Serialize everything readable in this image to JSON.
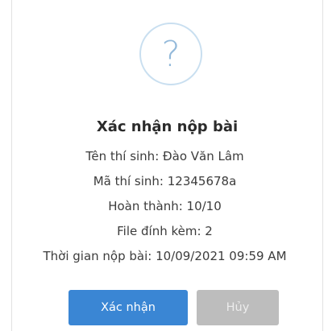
{
  "dialog": {
    "icon": "question-mark-icon",
    "icon_glyph": "?",
    "title": "Xác nhận nộp bài",
    "lines": [
      "Tên thí sinh: Đào Văn Lâm",
      "Mã thí sinh: 12345678a",
      "Hoàn thành: 10/10",
      "File đính kèm: 2",
      "Thời gian nộp bài: 10/09/2021 09:59 AM"
    ],
    "confirm_label": "Xác nhận",
    "cancel_label": "Hủy"
  },
  "colors": {
    "confirm_button": "#3a86d4",
    "cancel_button": "#bdbdbd",
    "icon": "#93b9da"
  }
}
